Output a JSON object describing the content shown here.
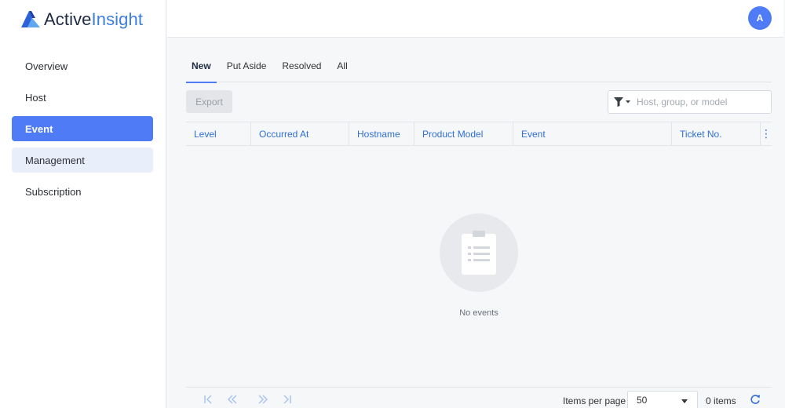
{
  "brand": {
    "part1": "Active",
    "part2": "Insight",
    "accent": "#4f7cf6"
  },
  "user": {
    "avatar_initial": "A"
  },
  "sidebar": {
    "items": [
      {
        "label": "Overview",
        "state": "default"
      },
      {
        "label": "Host",
        "state": "default"
      },
      {
        "label": "Event",
        "state": "active"
      },
      {
        "label": "Management",
        "state": "hover"
      },
      {
        "label": "Subscription",
        "state": "default"
      }
    ]
  },
  "tabs": [
    {
      "label": "New",
      "active": true
    },
    {
      "label": "Put Aside",
      "active": false
    },
    {
      "label": "Resolved",
      "active": false
    },
    {
      "label": "All",
      "active": false
    }
  ],
  "toolbar": {
    "export_label": "Export",
    "search_placeholder": "Host, group, or model",
    "filter_icon": "filter-icon"
  },
  "table": {
    "columns": [
      "Level",
      "Occurred At",
      "Hostname",
      "Product Model",
      "Event",
      "Ticket No."
    ],
    "rows": [],
    "empty_text": "No events"
  },
  "pagination": {
    "items_per_page_label": "Items per page",
    "items_per_page_value": "50",
    "item_count": "0 items"
  }
}
